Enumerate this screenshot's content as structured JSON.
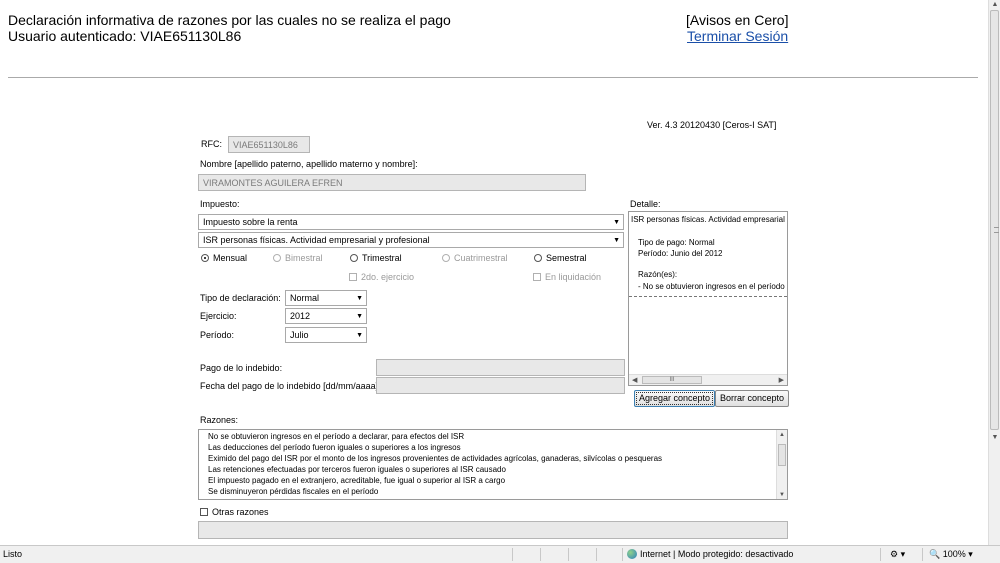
{
  "header": {
    "title": "Declaración informativa de razones por las cuales no se realiza el pago",
    "user": "Usuario autenticado: VIAE651130L86",
    "avisos": "[Avisos en Cero]",
    "logout": "Terminar Sesión"
  },
  "version": "Ver. 4.3   20120430   [Ceros-I SAT]",
  "form": {
    "rfc_label": "RFC:",
    "rfc_value": "VIAE651130L86",
    "nombre_label": "Nombre [apellido paterno, apellido materno y nombre]:",
    "nombre_value": "VIRAMONTES AGUILERA EFREN",
    "impuesto_label": "Impuesto:",
    "impuesto_value": "Impuesto sobre la renta",
    "subimpuesto_value": "ISR personas físicas. Actividad empresarial y profesional",
    "periodicidad": {
      "mensual": "Mensual",
      "bimestral": "Bimestral",
      "trimestral": "Trimestral",
      "cuatrimestral": "Cuatrimestral",
      "semestral": "Semestral",
      "selected": "Mensual"
    },
    "segundo_ejercicio": "2do. ejercicio",
    "en_liquidacion": "En liquidación",
    "tipo_label": "Tipo de declaración:",
    "tipo_value": "Normal",
    "ejercicio_label": "Ejercicio:",
    "ejercicio_value": "2012",
    "periodo_label": "Período:",
    "periodo_value": "Julio",
    "pago_indebido_label": "Pago de lo indebido:",
    "fecha_pago_label": "Fecha del pago de lo indebido [dd/mm/aaaa]:",
    "razones_label": "Razones:",
    "razones": [
      "No se obtuvieron ingresos en el período a declarar, para efectos del ISR",
      "Las deducciones del período fueron iguales o superiores a los ingresos",
      "Eximido del pago del ISR por el monto de los ingresos provenientes de actividades agrícolas, ganaderas, silvícolas o pesqueras",
      "Las retenciones efectuadas por terceros fueron iguales o superiores al ISR causado",
      "El impuesto pagado en el extranjero, acreditable, fue igual o superior al ISR a cargo",
      "Se disminuyeron pérdidas fiscales en el período"
    ],
    "otras_razones_label": "Otras razones"
  },
  "detalle": {
    "label": "Detalle:",
    "lines": [
      "ISR personas físicas. Actividad empresarial y profesional",
      "Tipo de pago: Normal",
      "Período: Junio del 2012",
      "Razón(es):",
      "-    No se obtuvieron ingresos en el período a declarar"
    ],
    "scroll_thumb": "III"
  },
  "buttons": {
    "agregar": "Agregar concepto",
    "borrar": "Borrar concepto"
  },
  "statusbar": {
    "left": "Listo",
    "zone": "Internet | Modo protegido: desactivado",
    "zoom": "100%"
  }
}
